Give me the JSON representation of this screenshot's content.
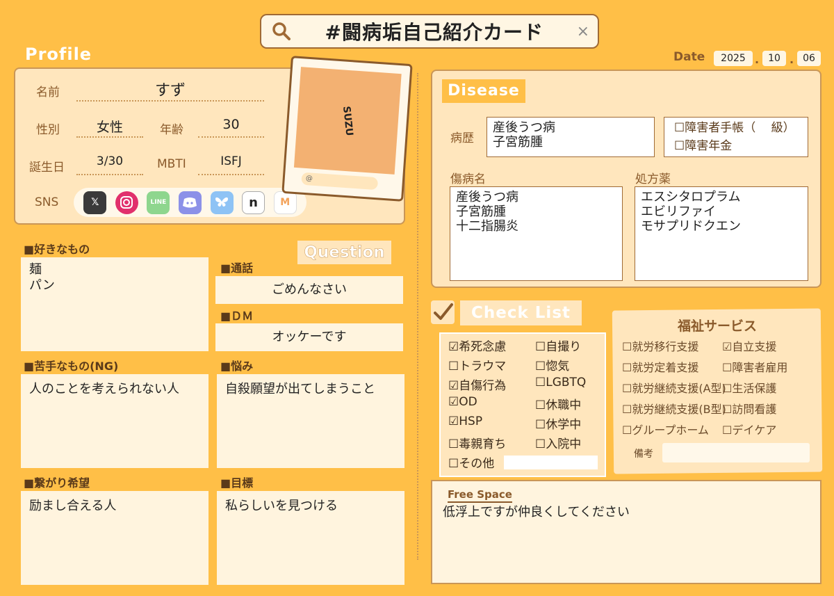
{
  "header": {
    "search_title": "#闘病垢自己紹介カード",
    "close": "×",
    "date_label": "Date",
    "date_year": "2025",
    "date_month": "10",
    "date_day": "06"
  },
  "profile": {
    "heading": "Profile",
    "name_label": "名前",
    "name_value": "すず",
    "gender_label": "性別",
    "gender_value": "女性",
    "age_label": "年齢",
    "age_value": "30",
    "birthday_label": "誕生日",
    "birthday_value": "3/30",
    "mbti_label": "MBTI",
    "mbti_value": "ISFJ",
    "sns_label": "SNS",
    "photo_text": "SUZU",
    "photo_handle": "@"
  },
  "sns_icons": [
    "x-icon",
    "instagram-icon",
    "line-icon",
    "discord-icon",
    "bluesky-icon",
    "note-icon",
    "misskey-icon"
  ],
  "question": {
    "heading": "Question",
    "likes_label": "■好きなもの",
    "likes_value_1": "麺",
    "likes_value_2": "パン",
    "call_label": "■通話",
    "call_value": "ごめんなさい",
    "dm_label": "■ＤＭ",
    "dm_value": "オッケーです",
    "dislikes_label": "■苦手なもの(NG)",
    "dislikes_value": "人のことを考えられない人",
    "worries_label": "■悩み",
    "worries_value": "自殺願望が出てしまうこと",
    "connect_label": "■繋がり希望",
    "connect_value": "励まし合える人",
    "goal_label": "■目標",
    "goal_value": "私らしいを見つける"
  },
  "disease": {
    "heading": "Disease",
    "history_label": "病歴",
    "history_1": "産後うつ病",
    "history_2": "子宮筋腫",
    "cert_1": "☐障害者手帳（　 級）",
    "cert_2": "☐障害年金",
    "diagnosis_label": "傷病名",
    "diagnosis_1": "産後うつ病",
    "diagnosis_2": "子宮筋腫",
    "diagnosis_3": "十二指腸炎",
    "meds_label": "処方薬",
    "meds_1": "エスシタロプラム",
    "meds_2": "エビリファイ",
    "meds_3": "モサプリドクエン"
  },
  "checklist": {
    "heading": "Check List",
    "col1": [
      "☑希死念慮",
      "☐トラウマ",
      "☑自傷行為",
      "☑OD",
      "☑HSP",
      "☐毒親育ち",
      "☐その他"
    ],
    "col2": [
      "☐自撮り",
      "☐惚気",
      "☐LGBTQ",
      "☐休職中",
      "☐休学中",
      "☐入院中"
    ]
  },
  "welfare": {
    "heading": "福祉サービス",
    "col1": [
      "☐就労移行支援",
      "☐就労定着支援",
      "☐就労継続支援(A型)",
      "☐就労継続支援(B型)",
      "☐グループホーム"
    ],
    "col2": [
      "☑自立支援",
      "☐障害者雇用",
      "☐生活保護",
      "☐訪問看護",
      "☐デイケア"
    ],
    "note_label": "備考"
  },
  "free_space": {
    "heading": "Free Space",
    "text": "低浮上ですが仲良くしてください"
  },
  "colors": {
    "background": "#FFBF47",
    "panel": "#FFE6BD",
    "border": "#C99657",
    "accent": "#8A5A2B"
  }
}
